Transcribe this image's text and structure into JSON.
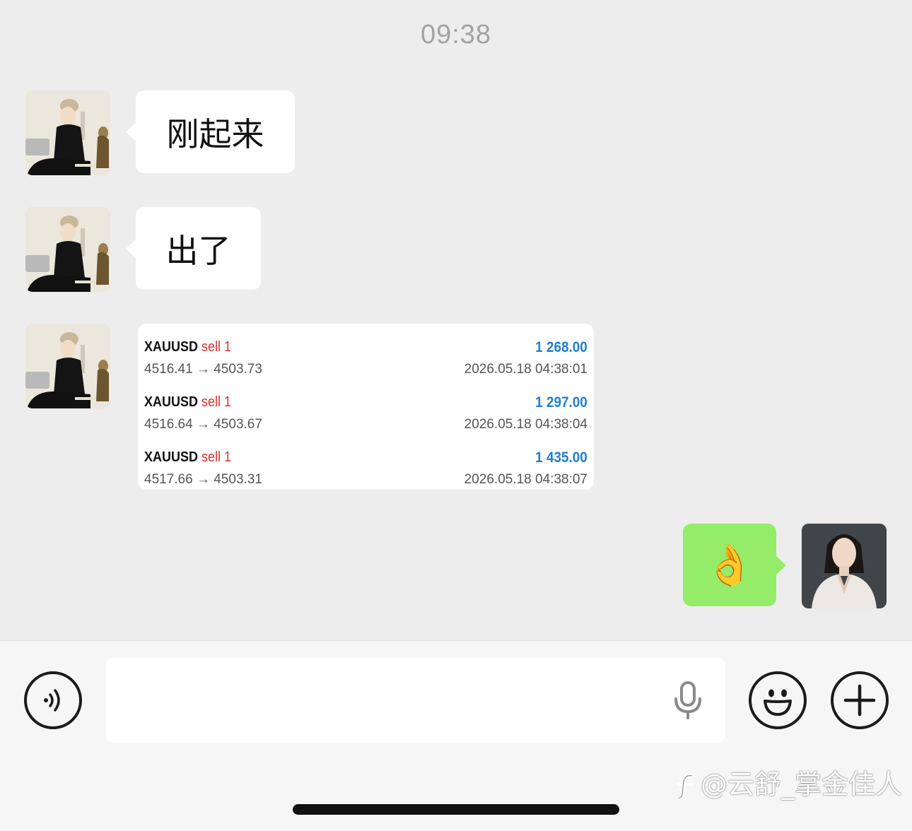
{
  "status": {
    "time": "09:38"
  },
  "messages": [
    {
      "sender": "contact",
      "type": "text",
      "text": "刚起来"
    },
    {
      "sender": "contact",
      "type": "text",
      "text": "出了"
    },
    {
      "sender": "contact",
      "type": "trade-card",
      "trades": [
        {
          "symbol": "XAUUSD",
          "side": "sell 1",
          "profit": "1 268.00",
          "prices": "4516.41 → 4503.73",
          "time": "2026.05.18 04:38:01"
        },
        {
          "symbol": "XAUUSD",
          "side": "sell 1",
          "profit": "1 297.00",
          "prices": "4516.64 → 4503.67",
          "time": "2026.05.18 04:38:04"
        },
        {
          "symbol": "XAUUSD",
          "side": "sell 1",
          "profit": "1 435.00",
          "prices": "4517.66 → 4503.31",
          "time": "2026.05.18 04:38:07"
        }
      ]
    },
    {
      "sender": "me",
      "type": "emoji",
      "text": "👌"
    }
  ],
  "input_bar": {
    "voice_icon": "voice-toggle-icon",
    "mic_icon": "microphone-icon",
    "emoji_icon": "smiley-icon",
    "plus_icon": "plus-icon"
  },
  "watermark": "@云舒_掌金佳人",
  "colors": {
    "background": "#ededed",
    "bubble_in": "#ffffff",
    "bubble_out": "#95ec69",
    "profit": "#1f7fd1",
    "sell": "#d8322b"
  }
}
